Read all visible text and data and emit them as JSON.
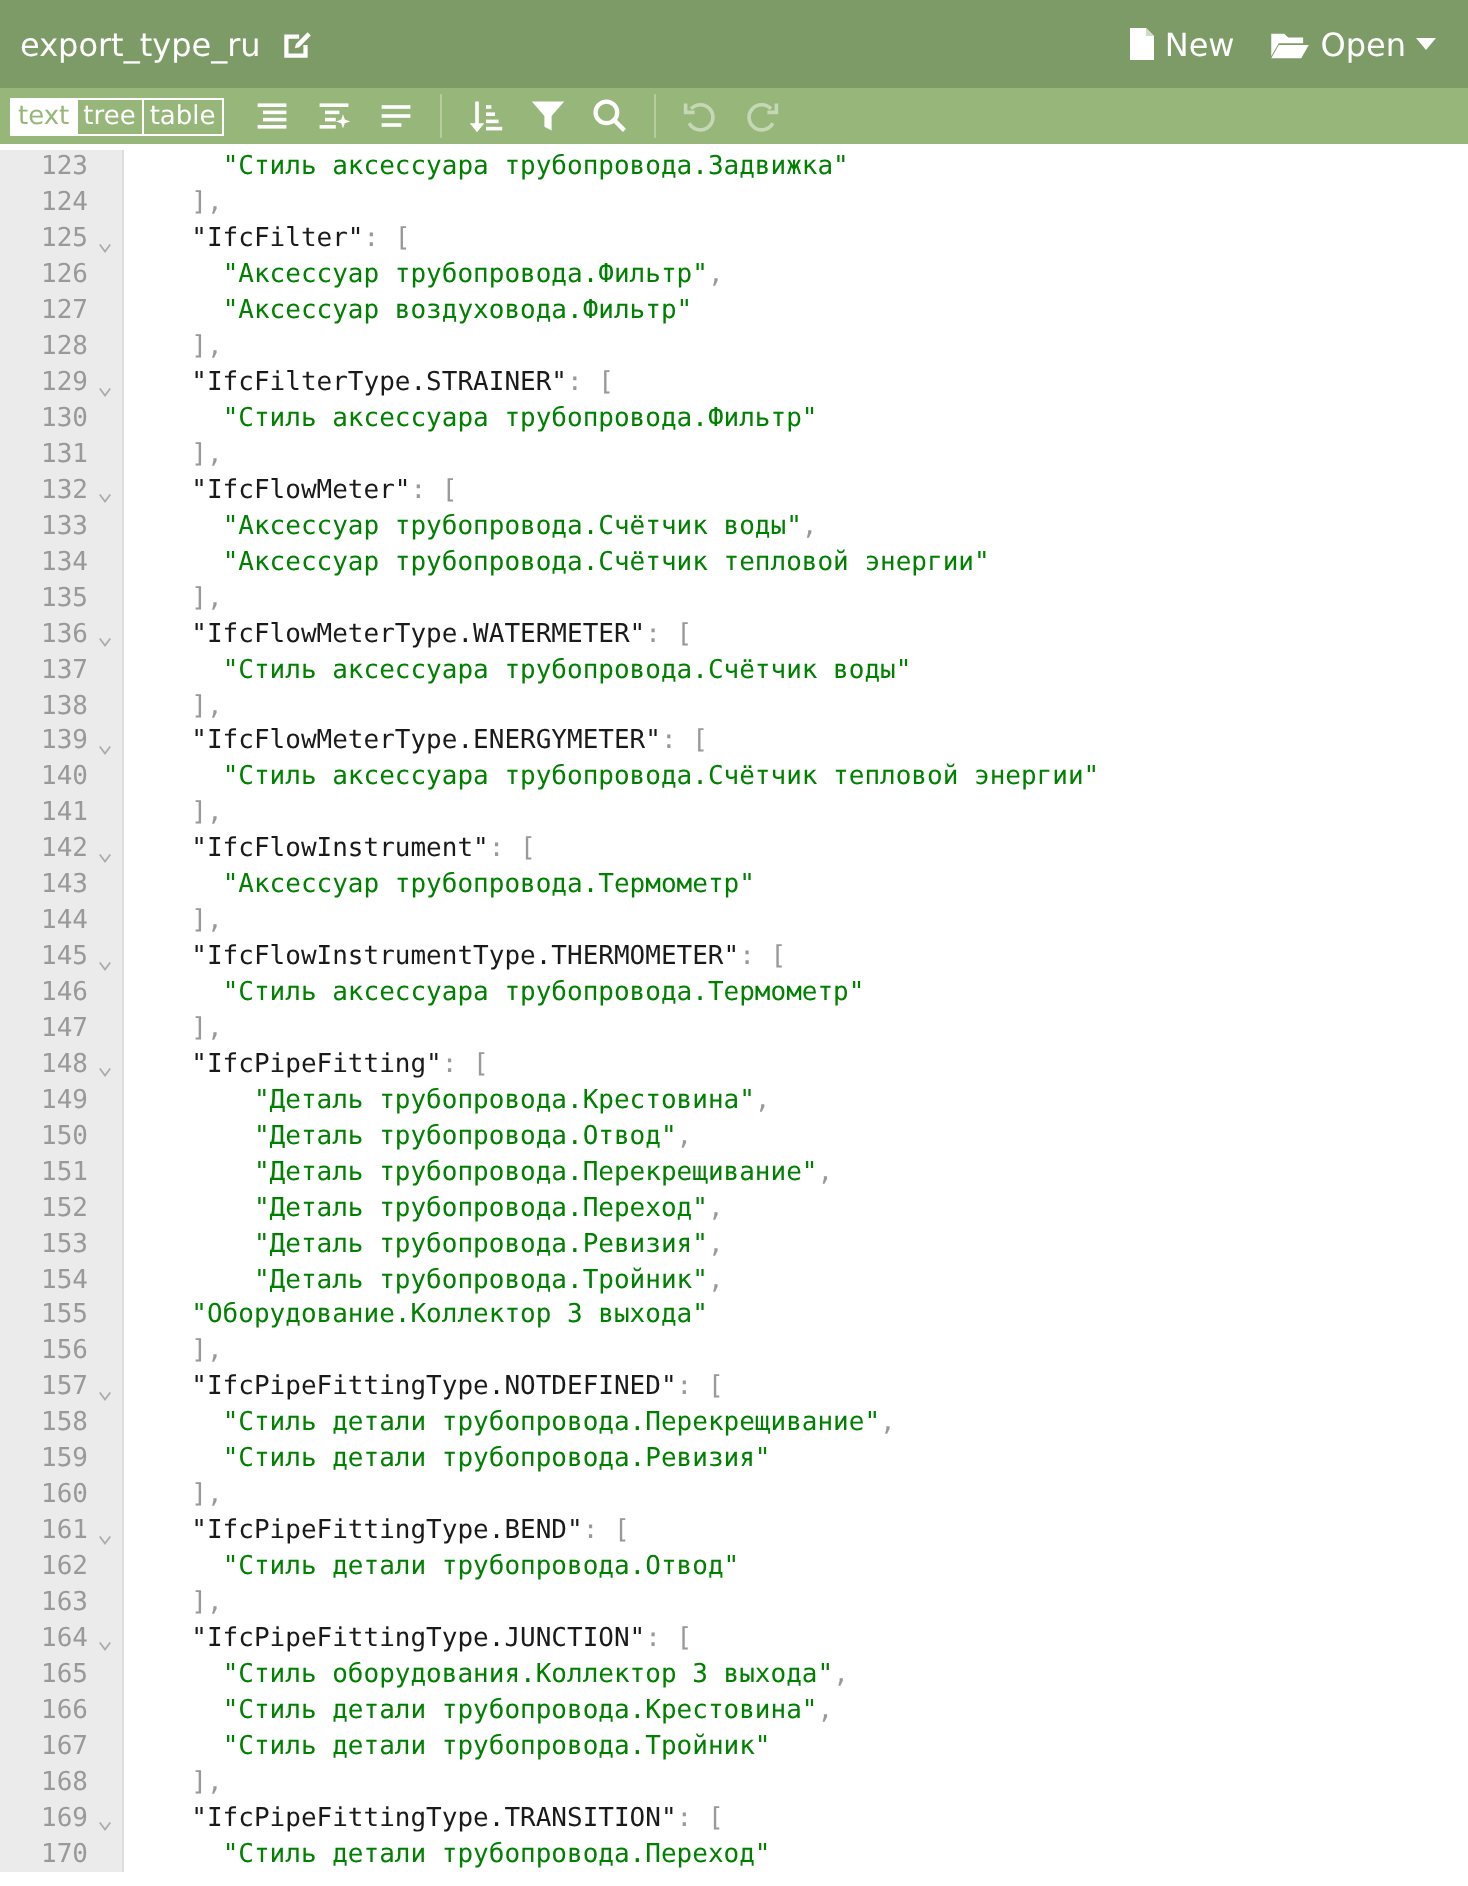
{
  "header": {
    "title": "export_type_ru",
    "actions": [
      {
        "kind": "new",
        "label": "New"
      },
      {
        "kind": "open",
        "label": "Open"
      }
    ]
  },
  "toolbar": {
    "modes": [
      {
        "label": "text",
        "selected": true
      },
      {
        "label": "tree",
        "selected": false
      },
      {
        "label": "table",
        "selected": false
      }
    ],
    "tools": [
      {
        "kind": "format",
        "disabled": false
      },
      {
        "kind": "smart-format",
        "disabled": false
      },
      {
        "kind": "compact",
        "disabled": false
      },
      {
        "kind": "sort",
        "disabled": false
      },
      {
        "kind": "filter",
        "disabled": false
      },
      {
        "kind": "search",
        "disabled": false
      },
      {
        "kind": "undo",
        "disabled": true
      },
      {
        "kind": "redo",
        "disabled": true
      }
    ]
  },
  "editor": {
    "lines": [
      {
        "number": "123",
        "fold": false,
        "kind": "item",
        "tokens": [
          {
            "kind": "str",
            "text": "\"Стиль аксессуара трубопровода.Задвижка\""
          }
        ]
      },
      {
        "number": "124",
        "fold": false,
        "kind": "close",
        "tokens": [
          {
            "kind": "punct",
            "text": "],"
          }
        ]
      },
      {
        "number": "125",
        "fold": true,
        "kind": "key",
        "tokens": [
          {
            "kind": "key",
            "text": "\"IfcFilter\""
          },
          {
            "kind": "punct",
            "text": ": ["
          }
        ]
      },
      {
        "number": "126",
        "fold": false,
        "kind": "item",
        "tokens": [
          {
            "kind": "str",
            "text": "\"Аксессуар трубопровода.Фильтр\""
          },
          {
            "kind": "punct",
            "text": ","
          }
        ]
      },
      {
        "number": "127",
        "fold": false,
        "kind": "item",
        "tokens": [
          {
            "kind": "str",
            "text": "\"Аксессуар воздуховода.Фильтр\""
          }
        ]
      },
      {
        "number": "128",
        "fold": false,
        "kind": "close",
        "tokens": [
          {
            "kind": "punct",
            "text": "],"
          }
        ]
      },
      {
        "number": "129",
        "fold": true,
        "kind": "key",
        "tokens": [
          {
            "kind": "key",
            "text": "\"IfcFilterType.STRAINER\""
          },
          {
            "kind": "punct",
            "text": ": ["
          }
        ]
      },
      {
        "number": "130",
        "fold": false,
        "kind": "item",
        "tokens": [
          {
            "kind": "str",
            "text": "\"Стиль аксессуара трубопровода.Фильтр\""
          }
        ]
      },
      {
        "number": "131",
        "fold": false,
        "kind": "close",
        "tokens": [
          {
            "kind": "punct",
            "text": "],"
          }
        ]
      },
      {
        "number": "132",
        "fold": true,
        "kind": "key",
        "tokens": [
          {
            "kind": "key",
            "text": "\"IfcFlowMeter\""
          },
          {
            "kind": "punct",
            "text": ": ["
          }
        ]
      },
      {
        "number": "133",
        "fold": false,
        "kind": "item",
        "tokens": [
          {
            "kind": "str",
            "text": "\"Аксессуар трубопровода.Счётчик воды\""
          },
          {
            "kind": "punct",
            "text": ","
          }
        ]
      },
      {
        "number": "134",
        "fold": false,
        "kind": "item",
        "tokens": [
          {
            "kind": "str",
            "text": "\"Аксессуар трубопровода.Счётчик тепловой энергии\""
          }
        ]
      },
      {
        "number": "135",
        "fold": false,
        "kind": "close",
        "tokens": [
          {
            "kind": "punct",
            "text": "],"
          }
        ]
      },
      {
        "number": "136",
        "fold": true,
        "kind": "key",
        "tokens": [
          {
            "kind": "key",
            "text": "\"IfcFlowMeterType.WATERMETER\""
          },
          {
            "kind": "punct",
            "text": ": ["
          }
        ]
      },
      {
        "number": "137",
        "fold": false,
        "kind": "item",
        "tokens": [
          {
            "kind": "str",
            "text": "\"Стиль аксессуара трубопровода.Счётчик воды\""
          }
        ]
      },
      {
        "number": "138",
        "fold": false,
        "kind": "close",
        "tokens": [
          {
            "kind": "punct",
            "text": "],"
          }
        ]
      },
      {
        "number": "139",
        "fold": true,
        "kind": "key",
        "tokens": [
          {
            "kind": "key",
            "text": "\"IfcFlowMeterType.ENERGYMETER\""
          },
          {
            "kind": "punct",
            "text": ": ["
          }
        ]
      },
      {
        "number": "140",
        "fold": false,
        "kind": "item",
        "tokens": [
          {
            "kind": "str",
            "text": "\"Стиль аксессуара трубопровода.Счётчик тепловой энергии\""
          }
        ]
      },
      {
        "number": "141",
        "fold": false,
        "kind": "close",
        "tokens": [
          {
            "kind": "punct",
            "text": "],"
          }
        ]
      },
      {
        "number": "142",
        "fold": true,
        "kind": "key",
        "tokens": [
          {
            "kind": "key",
            "text": "\"IfcFlowInstrument\""
          },
          {
            "kind": "punct",
            "text": ": ["
          }
        ]
      },
      {
        "number": "143",
        "fold": false,
        "kind": "item",
        "tokens": [
          {
            "kind": "str",
            "text": "\"Аксессуар трубопровода.Термометр\""
          }
        ]
      },
      {
        "number": "144",
        "fold": false,
        "kind": "close",
        "tokens": [
          {
            "kind": "punct",
            "text": "],"
          }
        ]
      },
      {
        "number": "145",
        "fold": true,
        "kind": "key",
        "tokens": [
          {
            "kind": "key",
            "text": "\"IfcFlowInstrumentType.THERMOMETER\""
          },
          {
            "kind": "punct",
            "text": ": ["
          }
        ]
      },
      {
        "number": "146",
        "fold": false,
        "kind": "item",
        "tokens": [
          {
            "kind": "str",
            "text": "\"Стиль аксессуара трубопровода.Термометр\""
          }
        ]
      },
      {
        "number": "147",
        "fold": false,
        "kind": "close",
        "tokens": [
          {
            "kind": "punct",
            "text": "],"
          }
        ]
      },
      {
        "number": "148",
        "fold": true,
        "kind": "key",
        "tokens": [
          {
            "kind": "key",
            "text": "\"IfcPipeFitting\""
          },
          {
            "kind": "punct",
            "text": ": ["
          }
        ]
      },
      {
        "number": "149",
        "fold": false,
        "kind": "deep-item",
        "tokens": [
          {
            "kind": "str",
            "text": "\"Деталь трубопровода.Крестовина\""
          },
          {
            "kind": "punct",
            "text": ","
          }
        ]
      },
      {
        "number": "150",
        "fold": false,
        "kind": "deep-item",
        "tokens": [
          {
            "kind": "str",
            "text": "\"Деталь трубопровода.Отвод\""
          },
          {
            "kind": "punct",
            "text": ","
          }
        ]
      },
      {
        "number": "151",
        "fold": false,
        "kind": "deep-item",
        "tokens": [
          {
            "kind": "str",
            "text": "\"Деталь трубопровода.Перекрещивание\""
          },
          {
            "kind": "punct",
            "text": ","
          }
        ]
      },
      {
        "number": "152",
        "fold": false,
        "kind": "deep-item",
        "tokens": [
          {
            "kind": "str",
            "text": "\"Деталь трубопровода.Переход\""
          },
          {
            "kind": "punct",
            "text": ","
          }
        ]
      },
      {
        "number": "153",
        "fold": false,
        "kind": "deep-item",
        "tokens": [
          {
            "kind": "str",
            "text": "\"Деталь трубопровода.Ревизия\""
          },
          {
            "kind": "punct",
            "text": ","
          }
        ]
      },
      {
        "number": "154",
        "fold": false,
        "kind": "deep-item",
        "tokens": [
          {
            "kind": "str",
            "text": "\"Деталь трубопровода.Тройник\""
          },
          {
            "kind": "punct",
            "text": ","
          }
        ]
      },
      {
        "number": "155",
        "fold": false,
        "kind": "outer-item",
        "tokens": [
          {
            "kind": "str",
            "text": "\"Оборудование.Коллектор 3 выхода\""
          }
        ]
      },
      {
        "number": "156",
        "fold": false,
        "kind": "close",
        "tokens": [
          {
            "kind": "punct",
            "text": "],"
          }
        ]
      },
      {
        "number": "157",
        "fold": true,
        "kind": "key",
        "tokens": [
          {
            "kind": "key",
            "text": "\"IfcPipeFittingType.NOTDEFINED\""
          },
          {
            "kind": "punct",
            "text": ": ["
          }
        ]
      },
      {
        "number": "158",
        "fold": false,
        "kind": "item",
        "tokens": [
          {
            "kind": "str",
            "text": "\"Стиль детали трубопровода.Перекрещивание\""
          },
          {
            "kind": "punct",
            "text": ","
          }
        ]
      },
      {
        "number": "159",
        "fold": false,
        "kind": "item",
        "tokens": [
          {
            "kind": "str",
            "text": "\"Стиль детали трубопровода.Ревизия\""
          }
        ]
      },
      {
        "number": "160",
        "fold": false,
        "kind": "close",
        "tokens": [
          {
            "kind": "punct",
            "text": "],"
          }
        ]
      },
      {
        "number": "161",
        "fold": true,
        "kind": "key",
        "tokens": [
          {
            "kind": "key",
            "text": "\"IfcPipeFittingType.BEND\""
          },
          {
            "kind": "punct",
            "text": ": ["
          }
        ]
      },
      {
        "number": "162",
        "fold": false,
        "kind": "item",
        "tokens": [
          {
            "kind": "str",
            "text": "\"Стиль детали трубопровода.Отвод\""
          }
        ]
      },
      {
        "number": "163",
        "fold": false,
        "kind": "close",
        "tokens": [
          {
            "kind": "punct",
            "text": "],"
          }
        ]
      },
      {
        "number": "164",
        "fold": true,
        "kind": "key",
        "tokens": [
          {
            "kind": "key",
            "text": "\"IfcPipeFittingType.JUNCTION\""
          },
          {
            "kind": "punct",
            "text": ": ["
          }
        ]
      },
      {
        "number": "165",
        "fold": false,
        "kind": "item",
        "tokens": [
          {
            "kind": "str",
            "text": "\"Стиль оборудования.Коллектор 3 выхода\""
          },
          {
            "kind": "punct",
            "text": ","
          }
        ]
      },
      {
        "number": "166",
        "fold": false,
        "kind": "item",
        "tokens": [
          {
            "kind": "str",
            "text": "\"Стиль детали трубопровода.Крестовина\""
          },
          {
            "kind": "punct",
            "text": ","
          }
        ]
      },
      {
        "number": "167",
        "fold": false,
        "kind": "item",
        "tokens": [
          {
            "kind": "str",
            "text": "\"Стиль детали трубопровода.Тройник\""
          }
        ]
      },
      {
        "number": "168",
        "fold": false,
        "kind": "close",
        "tokens": [
          {
            "kind": "punct",
            "text": "],"
          }
        ]
      },
      {
        "number": "169",
        "fold": true,
        "kind": "key",
        "tokens": [
          {
            "kind": "key",
            "text": "\"IfcPipeFittingType.TRANSITION\""
          },
          {
            "kind": "punct",
            "text": ": ["
          }
        ]
      },
      {
        "number": "170",
        "fold": false,
        "kind": "item",
        "tokens": [
          {
            "kind": "str",
            "text": "\"Стиль детали трубопровода.Переход\""
          }
        ]
      }
    ]
  }
}
